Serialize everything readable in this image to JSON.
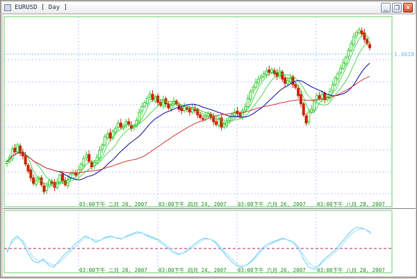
{
  "window": {
    "title": "EURUSD [ Day ]",
    "buttons": {
      "minimize": "_",
      "restore": "❐",
      "close": "×"
    }
  },
  "colors": {
    "background": "#ffffff",
    "frame": "#66cc66",
    "grid": "#b0c8f0",
    "candle_up": "#33cc33",
    "candle_down": "#cc2200",
    "ma_fast": "#33cc33",
    "ma_mid": "#0000aa",
    "ma_slow": "#cc3333",
    "osc_a": "#66ccee",
    "osc_b": "#99ddff",
    "osc_level": "#aa2266",
    "price_marker": "#66bbff"
  },
  "price_label": "1.4018",
  "time_labels": [
    "03:00下午 二月 20, 2007",
    "03:00下午 四月 24, 2007",
    "03:00下午 六月 26, 2007",
    "03:00下午 八月 28, 2007"
  ],
  "chart_data": [
    {
      "type": "candlestick",
      "title": "EURUSD [ Day ]",
      "indicators": [
        "moving average (fast)",
        "moving average (medium)",
        "moving average (slow)"
      ],
      "last_price": 1.4018,
      "x_tick_labels": [
        "03:00下午 二月 20, 2007",
        "03:00下午 四月 24, 2007",
        "03:00下午 六月 26, 2007",
        "03:00下午 八月 28, 2007"
      ],
      "grid": true,
      "close_shape": [
        0.04,
        0.07,
        0.13,
        0.11,
        0.16,
        0.1,
        0.08,
        0.02,
        -0.03,
        -0.08,
        -0.12,
        -0.1,
        -0.08,
        -0.13,
        -0.18,
        -0.14,
        -0.1,
        -0.12,
        -0.15,
        -0.11,
        -0.06,
        -0.1,
        -0.13,
        -0.09,
        -0.05,
        -0.04,
        -0.06,
        -0.02,
        0.02,
        0.06,
        0.09,
        0.04,
        0.0,
        0.03,
        0.07,
        0.12,
        0.16,
        0.22,
        0.24,
        0.21,
        0.26,
        0.28,
        0.32,
        0.29,
        0.3,
        0.33,
        0.31,
        0.28,
        0.3,
        0.34,
        0.4,
        0.44,
        0.47,
        0.5,
        0.53,
        0.49,
        0.51,
        0.47,
        0.45,
        0.49,
        0.46,
        0.43,
        0.45,
        0.48,
        0.46,
        0.42,
        0.41,
        0.44,
        0.42,
        0.4,
        0.43,
        0.41,
        0.38,
        0.36,
        0.35,
        0.37,
        0.39,
        0.36,
        0.33,
        0.31,
        0.35,
        0.29,
        0.31,
        0.33,
        0.36,
        0.38,
        0.4,
        0.39,
        0.37,
        0.41,
        0.44,
        0.5,
        0.55,
        0.58,
        0.62,
        0.64,
        0.66,
        0.68,
        0.7,
        0.69,
        0.71,
        0.68,
        0.66,
        0.7,
        0.64,
        0.61,
        0.63,
        0.65,
        0.6,
        0.58,
        0.52,
        0.46,
        0.38,
        0.32,
        0.4,
        0.42,
        0.48,
        0.52,
        0.5,
        0.53,
        0.49,
        0.51,
        0.55,
        0.6,
        0.65,
        0.68,
        0.72,
        0.76,
        0.8,
        0.85,
        0.9,
        0.95,
        0.98,
        1.0,
        0.97,
        0.93,
        0.9,
        0.87
      ]
    },
    {
      "type": "line",
      "title": "oscillator",
      "series_a_shape": [
        -0.2,
        0.4,
        0.6,
        0.3,
        -0.2,
        -0.6,
        -0.7,
        -0.5,
        -0.8,
        -0.9,
        -0.6,
        -0.3,
        -0.1,
        0.2,
        0.4,
        0.6,
        0.5,
        0.3,
        0.4,
        0.55,
        0.6,
        0.5,
        0.45,
        0.6,
        0.7,
        0.8,
        0.75,
        0.6,
        0.5,
        0.4,
        0.2,
        0.0,
        -0.2,
        -0.3,
        -0.2,
        0.0,
        0.2,
        0.4,
        0.5,
        0.45,
        0.3,
        0.0,
        -0.3,
        -0.6,
        -0.8,
        -0.9,
        -0.8,
        -0.6,
        -0.3,
        0.0,
        0.2,
        0.3,
        0.4,
        0.5,
        0.4,
        0.3,
        0.0,
        -0.5,
        -0.9,
        -1.0,
        -0.8,
        -0.5,
        -0.3,
        -0.1,
        0.2,
        0.5,
        0.8,
        1.0,
        1.0,
        0.9,
        0.7
      ],
      "series_b_shape": [
        -0.1,
        0.3,
        0.5,
        0.4,
        0.0,
        -0.4,
        -0.6,
        -0.6,
        -0.7,
        -0.8,
        -0.7,
        -0.45,
        -0.2,
        0.05,
        0.3,
        0.5,
        0.5,
        0.4,
        0.4,
        0.5,
        0.55,
        0.52,
        0.48,
        0.55,
        0.65,
        0.72,
        0.74,
        0.65,
        0.55,
        0.45,
        0.3,
        0.1,
        -0.1,
        -0.25,
        -0.22,
        -0.08,
        0.1,
        0.3,
        0.45,
        0.45,
        0.35,
        0.1,
        -0.2,
        -0.45,
        -0.7,
        -0.85,
        -0.82,
        -0.65,
        -0.4,
        -0.1,
        0.1,
        0.25,
        0.35,
        0.45,
        0.42,
        0.32,
        0.1,
        -0.3,
        -0.7,
        -0.9,
        -0.85,
        -0.6,
        -0.4,
        -0.2,
        0.05,
        0.35,
        0.65,
        0.85,
        0.95,
        0.9,
        0.78
      ],
      "level_line": true
    }
  ]
}
